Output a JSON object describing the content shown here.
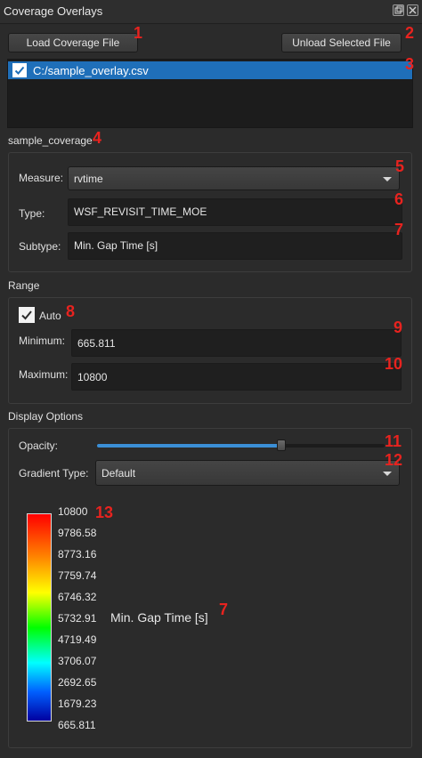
{
  "window": {
    "title": "Coverage Overlays",
    "float_icon": "float-icon",
    "close_icon": "close-icon"
  },
  "toolbar": {
    "load_label": "Load Coverage File",
    "unload_label": "Unload Selected File"
  },
  "files": [
    {
      "path": "C:/sample_overlay.csv",
      "checked": true,
      "selected": true
    }
  ],
  "coverage": {
    "name": "sample_coverage",
    "measure_label": "Measure:",
    "measure_value": "rvtime",
    "type_label": "Type:",
    "type_value": "WSF_REVISIT_TIME_MOE",
    "subtype_label": "Subtype:",
    "subtype_value": "Min. Gap Time [s]"
  },
  "range": {
    "title": "Range",
    "auto_label": "Auto",
    "auto_checked": true,
    "min_label": "Minimum:",
    "min_value": "665.811",
    "max_label": "Maximum:",
    "max_value": "10800"
  },
  "display": {
    "title": "Display Options",
    "opacity_label": "Opacity:",
    "opacity_value": 0.64,
    "gradient_label": "Gradient Type:",
    "gradient_value": "Default"
  },
  "legend": {
    "ticks": [
      "10800",
      "9786.58",
      "8773.16",
      "7759.74",
      "6746.32",
      "5732.91",
      "4719.49",
      "3706.07",
      "2692.65",
      "1679.23",
      "665.811"
    ],
    "caption": "Min. Gap Time [s]"
  },
  "annotations": [
    "1",
    "2",
    "3",
    "4",
    "5",
    "6",
    "7",
    "8",
    "9",
    "10",
    "11",
    "12",
    "13",
    "7"
  ],
  "colors": {
    "selection": "#1f6fb9",
    "annotation": "#e8231f",
    "slider": "#3b8fd6"
  }
}
